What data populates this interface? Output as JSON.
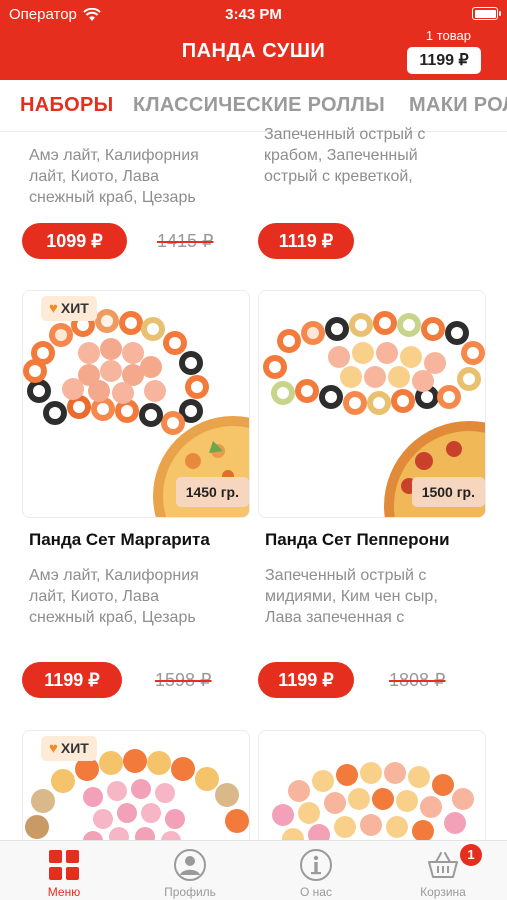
{
  "status_bar": {
    "carrier": "Оператор",
    "time": "3:43 PM"
  },
  "header": {
    "title": "ПАНДА СУШИ",
    "cart_count": "1 товар",
    "cart_total": "1199 ₽"
  },
  "tabs": [
    "НАБОРЫ",
    "КЛАССИЧЕСКИЕ РОЛЛЫ",
    "МАКИ РОЛ"
  ],
  "products_top": [
    {
      "desc_lines": [
        "Амэ лайт, Калифорния",
        "лайт, Киото, Лава",
        "снежный краб, Цезарь"
      ],
      "price": "1099 ₽",
      "old_price": "1415 ₽"
    },
    {
      "desc_lines": [
        "Запеченный острый с",
        "крабом, Запеченный",
        "острый с креветкой,"
      ],
      "price": "1119 ₽"
    }
  ],
  "products": [
    {
      "badge": "ХИТ",
      "weight": "1450 гр.",
      "name": "Панда Сет Маргарита",
      "desc_lines": [
        "Амэ лайт, Калифорния",
        "лайт, Киото, Лава",
        "снежный краб, Цезарь"
      ],
      "price": "1199 ₽",
      "old_price": "1598 ₽"
    },
    {
      "weight": "1500 гр.",
      "name": "Панда Сет Пепперони",
      "desc_lines": [
        "Запеченный острый с",
        "мидиями, Ким чен сыр,",
        "Лава запеченная с"
      ],
      "price": "1199 ₽",
      "old_price": "1808 ₽"
    }
  ],
  "products_bottom": [
    {
      "badge": "ХИТ"
    },
    {}
  ],
  "tabbar": {
    "items": [
      {
        "label": "Меню",
        "icon": "menu-grid-icon"
      },
      {
        "label": "Профиль",
        "icon": "profile-icon"
      },
      {
        "label": "О нас",
        "icon": "info-icon"
      },
      {
        "label": "Корзина",
        "icon": "cart-icon",
        "badge": "1"
      }
    ]
  },
  "colors": {
    "accent": "#e52e1e",
    "badge_bg": "#fdebd8",
    "weight_bg": "#f7d6bf"
  }
}
